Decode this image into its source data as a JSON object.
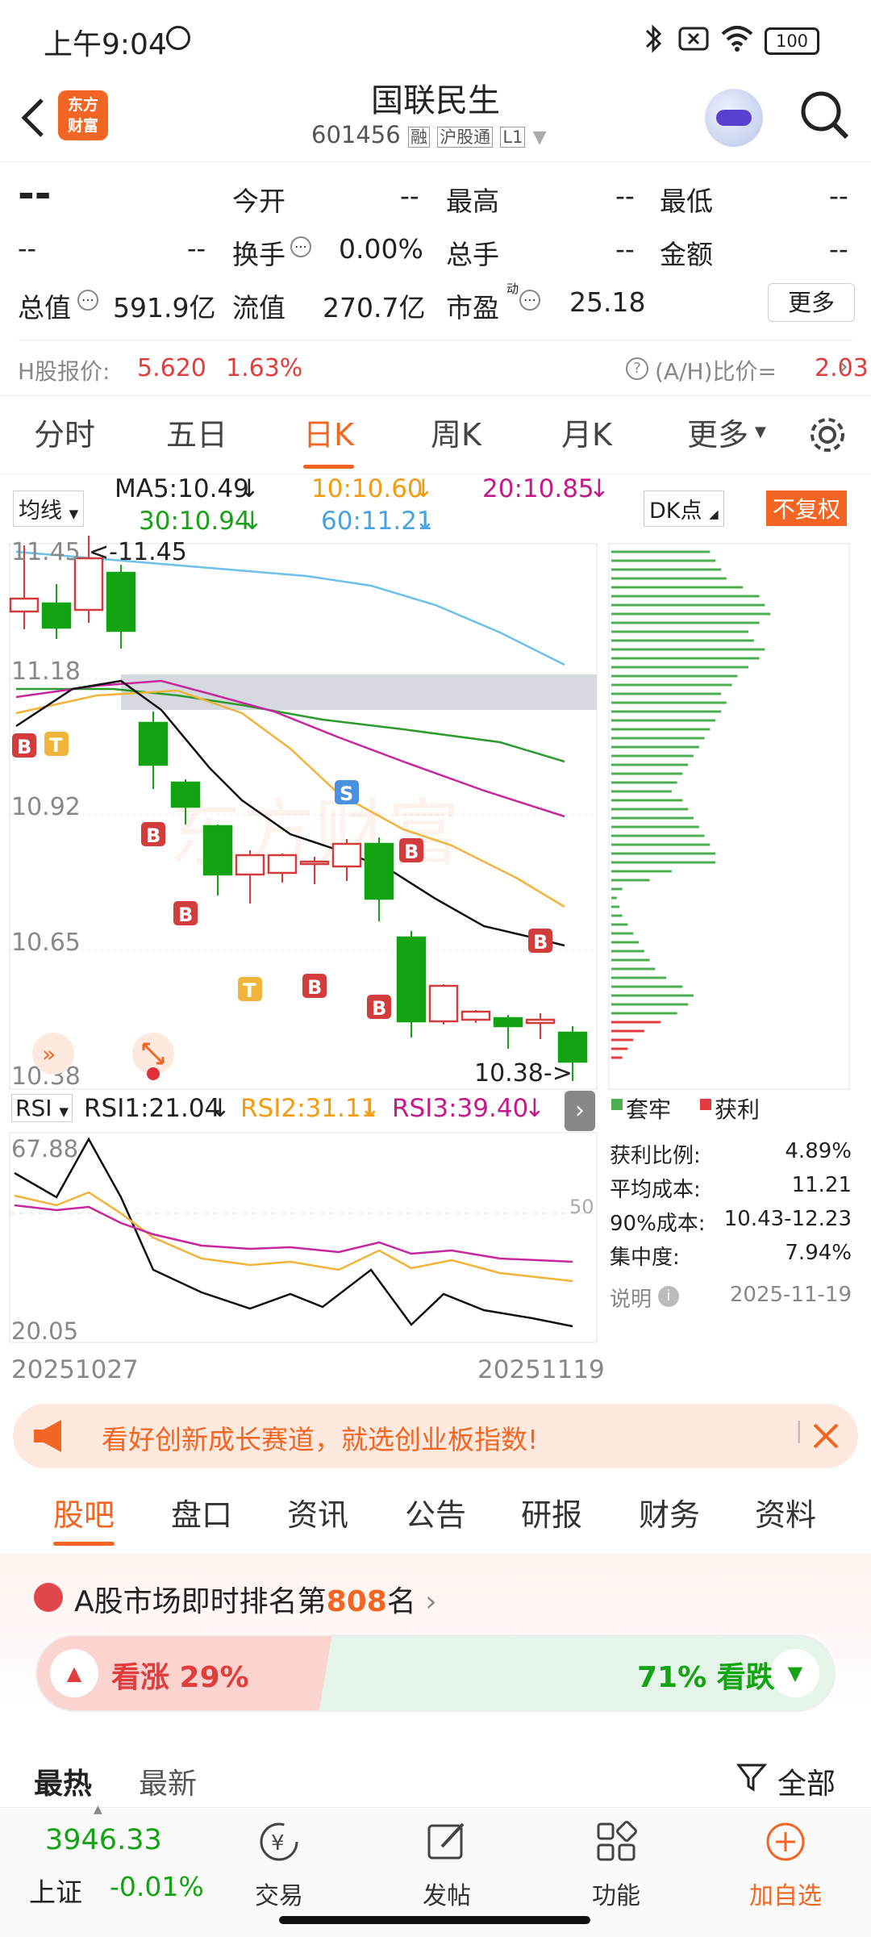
{
  "status_bar": {
    "time": "上午9:04",
    "battery": "100"
  },
  "header": {
    "logo_text_1": "东方",
    "logo_text_2": "财富",
    "stock_name": "国联民生",
    "stock_code": "601456",
    "tag_rong": "融",
    "tag_hgt": "沪股通",
    "tag_l1": "L1"
  },
  "quote": {
    "price": "--",
    "change": "--",
    "change_pct": "--",
    "open_label": "今开",
    "open_value": "--",
    "high_label": "最高",
    "high_value": "--",
    "low_label": "最低",
    "low_value": "--",
    "turnover_label": "换手",
    "turnover_value": "0.00%",
    "volume_label": "总手",
    "volume_value": "--",
    "amount_label": "金额",
    "amount_value": "--",
    "mktcap_label": "总值",
    "mktcap_value": "591.9亿",
    "float_label": "流值",
    "float_value": "270.7亿",
    "pe_label": "市盈",
    "pe_sup": "动",
    "pe_value": "25.18",
    "more_button": "更多",
    "h_label": "H股报价:",
    "h_price": "5.620",
    "h_pct": "1.63%",
    "ah_label": "(A/H)比价=",
    "ah_value": "2.03"
  },
  "tabs": [
    "分时",
    "五日",
    "日K",
    "周K",
    "月K",
    "更多"
  ],
  "active_tab": "日K",
  "ma_legend": {
    "selector": "均线",
    "ma5": "MA5:10.49",
    "ma10": "10:10.60",
    "ma20": "20:10.85",
    "ma30": "30:10.94",
    "ma60": "60:11.21",
    "dk": "DK点",
    "fq": "不复权"
  },
  "kline": {
    "y_labels": [
      "11.45",
      "11.18",
      "10.92",
      "10.65",
      "10.38"
    ],
    "max_label": "<-11.45",
    "min_label": "10.38->",
    "markers": {
      "b": "B",
      "t": "T",
      "s": "S"
    },
    "colors": {
      "up": "#d23c3c",
      "down": "#13a313",
      "ma5": "#111111",
      "ma10": "#f1b43a",
      "ma20": "#c8269e",
      "ma30": "#2c9a2c",
      "ma60": "#6cc0ea"
    }
  },
  "rsi": {
    "selector": "RSI",
    "rsi1": "RSI1:21.04",
    "rsi2": "RSI2:31.11",
    "rsi3": "RSI3:39.40",
    "top_label": "67.88",
    "mid_label": "50",
    "bottom_label": "20.05",
    "date_start": "20251027",
    "date_end": "20251119"
  },
  "chip": {
    "legend_trap": "套牢",
    "legend_profit": "获利",
    "rows": [
      {
        "label": "获利比例:",
        "value": "4.89%"
      },
      {
        "label": "平均成本:",
        "value": "11.21"
      },
      {
        "label": "90%成本:",
        "value": "10.43-12.23"
      },
      {
        "label": "集中度:",
        "value": "7.94%"
      }
    ],
    "note_label": "说明",
    "date": "2025-11-19"
  },
  "banner": {
    "text": "看好创新成长赛道，就选创业板指数!"
  },
  "subtabs": [
    "股吧",
    "盘口",
    "资讯",
    "公告",
    "研报",
    "财务",
    "资料"
  ],
  "active_subtab": "股吧",
  "rank": {
    "prefix": "A股市场即时排名第",
    "rank": "808",
    "suffix": "名"
  },
  "sentiment": {
    "up_label": "看涨 29%",
    "down_label": "71% 看跌",
    "up_fraction": 0.29
  },
  "feed": {
    "hot": "最热",
    "new": "最新",
    "filter": "全部"
  },
  "bottom_bar": {
    "index_value": "3946.33",
    "index_name": "上证",
    "index_change": "-0.01%",
    "trade": "交易",
    "post": "发帖",
    "func": "功能",
    "add": "加自选"
  }
}
